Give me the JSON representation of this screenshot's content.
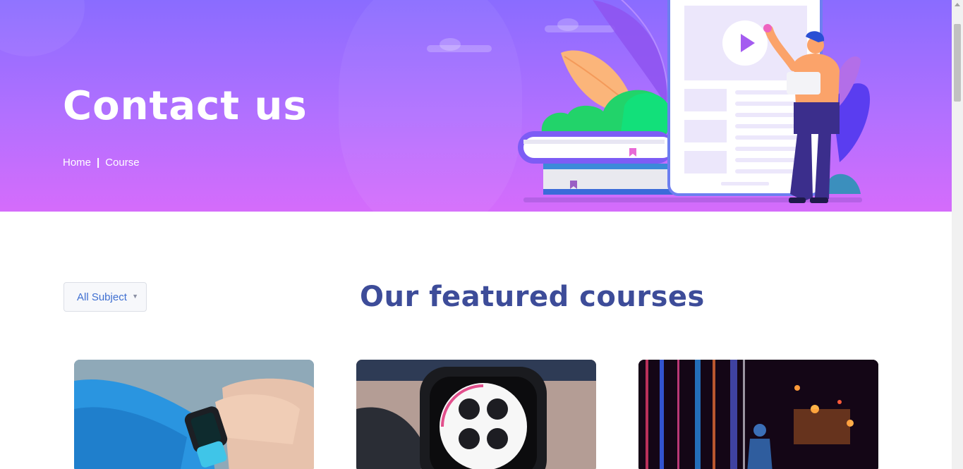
{
  "hero": {
    "title": "Contact us",
    "breadcrumb": {
      "home": "Home",
      "separator": "|",
      "current": "Course"
    }
  },
  "filter": {
    "selected": "All Subject"
  },
  "section": {
    "title": "Our featured courses"
  },
  "courses": [
    {
      "image": "smartwatch-on-wrist-photo"
    },
    {
      "image": "watch-face-closeup-photo"
    },
    {
      "image": "neon-night-street-photo"
    }
  ],
  "colors": {
    "hero_top": "#8a6cff",
    "hero_bottom": "#d56cfb",
    "title_blue": "#3d4c99",
    "select_text": "#3f6fd1"
  }
}
